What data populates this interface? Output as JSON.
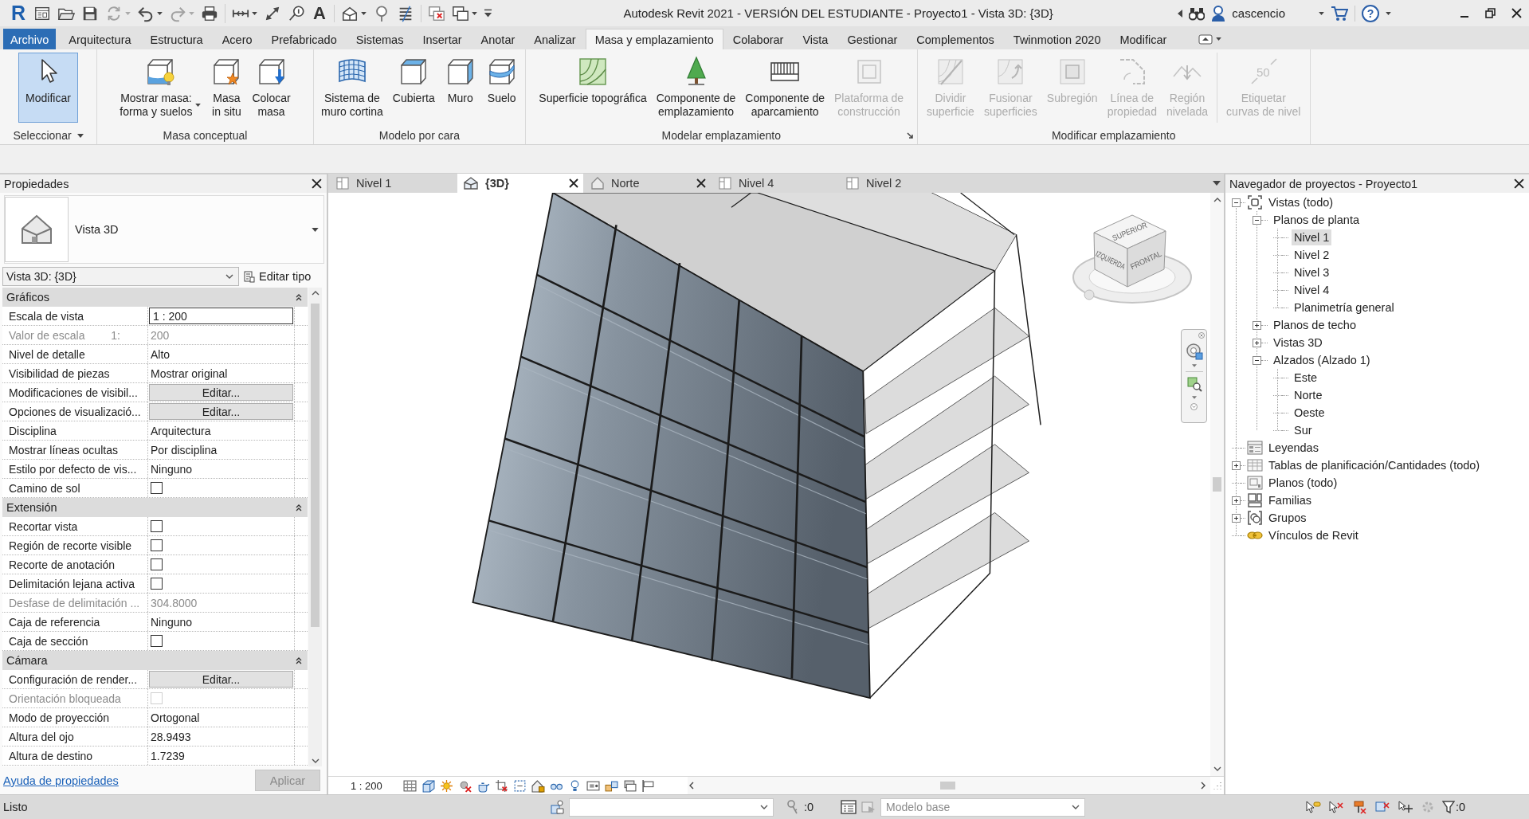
{
  "title_bar": {
    "quick_access": [
      {
        "items": [
          {
            "kind": "app",
            "glyph": "R",
            "disabled": false
          },
          {
            "kind": "home",
            "disabled": false
          },
          {
            "kind": "open",
            "disabled": false
          },
          {
            "kind": "save",
            "disabled": false
          },
          {
            "kind": "sync",
            "menu": true,
            "disabled": true
          },
          {
            "kind": "undo",
            "menu": true,
            "disabled": false
          },
          {
            "kind": "redo",
            "menu": true,
            "disabled": true
          },
          {
            "kind": "print",
            "disabled": false
          }
        ]
      },
      {
        "items": [
          {
            "kind": "measure",
            "menu": true,
            "disabled": false
          },
          {
            "kind": "dimension",
            "disabled": false
          },
          {
            "kind": "tag",
            "disabled": false
          },
          {
            "kind": "text",
            "glyph": "A",
            "disabled": false
          }
        ]
      },
      {
        "items": [
          {
            "kind": "view3d",
            "menu": true,
            "disabled": false
          },
          {
            "kind": "section",
            "disabled": false
          },
          {
            "kind": "thinlines",
            "disabled": false
          }
        ]
      },
      {
        "items": [
          {
            "kind": "closewindows",
            "disabled": false
          },
          {
            "kind": "switchwindows",
            "menu": true,
            "disabled": false
          },
          {
            "kind": "customize",
            "disabled": false
          }
        ]
      }
    ],
    "title": "Autodesk Revit 2021 - VERSIÓN DEL ESTUDIANTE - Proyecto1 - Vista 3D: {3D}",
    "user": "cascencio",
    "help_glyph": "?"
  },
  "ribbon": {
    "tabs": [
      {
        "label": "Archivo",
        "kind": "file",
        "selected": false
      },
      {
        "label": "Arquitectura",
        "kind": "tab",
        "selected": false
      },
      {
        "label": "Estructura",
        "kind": "tab",
        "selected": false
      },
      {
        "label": "Acero",
        "kind": "tab",
        "selected": false
      },
      {
        "label": "Prefabricado",
        "kind": "tab",
        "selected": false
      },
      {
        "label": "Sistemas",
        "kind": "tab",
        "selected": false
      },
      {
        "label": "Insertar",
        "kind": "tab",
        "selected": false
      },
      {
        "label": "Anotar",
        "kind": "tab",
        "selected": false
      },
      {
        "label": "Analizar",
        "kind": "tab",
        "selected": false
      },
      {
        "label": "Masa y emplazamiento",
        "kind": "tab",
        "selected": true
      },
      {
        "label": "Colaborar",
        "kind": "tab",
        "selected": false
      },
      {
        "label": "Vista",
        "kind": "tab",
        "selected": false
      },
      {
        "label": "Gestionar",
        "kind": "tab",
        "selected": false
      },
      {
        "label": "Complementos",
        "kind": "tab",
        "selected": false
      },
      {
        "label": "Twinmotion 2020",
        "kind": "tab",
        "selected": false
      },
      {
        "label": "Modificar",
        "kind": "tab",
        "selected": false
      }
    ],
    "panels": [
      {
        "title": "Seleccionar",
        "menu": true,
        "groups": [
          {
            "buttons": [
              {
                "kind": "select",
                "label": "Modificar",
                "active": true,
                "disabled": false
              }
            ]
          }
        ]
      },
      {
        "title": "Masa conceptual",
        "groups": [
          {
            "buttons": [
              {
                "kind": "showmass",
                "label": "Mostrar masa:\nforma y suelos",
                "active": false,
                "disabled": false,
                "menu": true
              },
              {
                "kind": "inplace",
                "label": "Masa\nin situ",
                "active": false,
                "disabled": false
              },
              {
                "kind": "placemass",
                "label": "Colocar\nmasa",
                "active": false,
                "disabled": false
              }
            ]
          }
        ]
      },
      {
        "title": "Modelo por cara",
        "groups": [
          {
            "buttons": [
              {
                "kind": "curtain",
                "label": "Sistema de\nmuro cortina",
                "active": false,
                "disabled": false
              },
              {
                "kind": "roof",
                "label": "Cubierta",
                "active": false,
                "disabled": false
              },
              {
                "kind": "wall",
                "label": "Muro",
                "active": false,
                "disabled": false
              },
              {
                "kind": "floor",
                "label": "Suelo",
                "active": false,
                "disabled": false
              }
            ]
          }
        ]
      },
      {
        "title": "Modelar emplazamiento",
        "launcher": true,
        "groups": [
          {
            "buttons": [
              {
                "kind": "topo",
                "label": "Superficie topográfica",
                "active": false,
                "disabled": false
              },
              {
                "kind": "sitecomp",
                "label": "Componente de\nemplazamiento",
                "active": false,
                "disabled": false
              },
              {
                "kind": "parking",
                "label": "Componente de\naparcamiento",
                "active": false,
                "disabled": false
              },
              {
                "kind": "pad",
                "label": "Plataforma de\nconstrucción",
                "active": false,
                "disabled": true
              }
            ]
          }
        ]
      },
      {
        "title": "Modificar emplazamiento",
        "groups": [
          {
            "buttons": [
              {
                "kind": "split",
                "label": "Dividir\nsuperficie",
                "active": false,
                "disabled": true
              },
              {
                "kind": "merge",
                "label": "Fusionar\nsuperficies",
                "active": false,
                "disabled": true
              },
              {
                "kind": "subregion",
                "label": "Subregión",
                "active": false,
                "disabled": true
              },
              {
                "kind": "propline",
                "label": "Línea de\npropiedad",
                "active": false,
                "disabled": true
              },
              {
                "kind": "graded",
                "label": "Región\nnivelada",
                "active": false,
                "disabled": true
              }
            ]
          },
          {
            "buttons": [
              {
                "kind": "contours",
                "label": "Etiquetar\ncurvas de nivel",
                "icon_text": "50",
                "active": false,
                "disabled": true
              }
            ]
          }
        ]
      }
    ]
  },
  "properties": {
    "title": "Propiedades",
    "type_name": "Vista 3D",
    "instance": "Vista 3D: {3D}",
    "edit_type": "Editar tipo",
    "sections": [
      {
        "title": "Gráficos",
        "expanded": true,
        "rows": [
          {
            "label": "Escala de vista",
            "kind": "input",
            "value": "1 : 200",
            "disabled": false
          },
          {
            "label": "Valor de escala",
            "unit": "1:",
            "kind": "text",
            "value": "200",
            "disabled": true
          },
          {
            "label": "Nivel de detalle",
            "kind": "text",
            "value": "Alto",
            "disabled": false
          },
          {
            "label": "Visibilidad de piezas",
            "kind": "text",
            "value": "Mostrar original",
            "disabled": false
          },
          {
            "label": "Modificaciones de visibil...",
            "kind": "button",
            "value": "Editar...",
            "disabled": false
          },
          {
            "label": "Opciones de visualizació...",
            "kind": "button",
            "value": "Editar...",
            "disabled": false
          },
          {
            "label": "Disciplina",
            "kind": "text",
            "value": "Arquitectura",
            "disabled": false
          },
          {
            "label": "Mostrar líneas ocultas",
            "kind": "text",
            "value": "Por disciplina",
            "disabled": false
          },
          {
            "label": "Estilo por defecto de vis...",
            "kind": "text",
            "value": "Ninguno",
            "disabled": false
          },
          {
            "label": "Camino de sol",
            "kind": "checkbox",
            "checked": false,
            "disabled": false
          }
        ]
      },
      {
        "title": "Extensión",
        "expanded": true,
        "rows": [
          {
            "label": "Recortar vista",
            "kind": "checkbox",
            "checked": false,
            "disabled": false
          },
          {
            "label": "Región de recorte visible",
            "kind": "checkbox",
            "checked": false,
            "disabled": false
          },
          {
            "label": "Recorte de anotación",
            "kind": "checkbox",
            "checked": false,
            "disabled": false
          },
          {
            "label": "Delimitación lejana activa",
            "kind": "checkbox",
            "checked": false,
            "disabled": false
          },
          {
            "label": "Desfase de delimitación ...",
            "kind": "text",
            "value": "304.8000",
            "disabled": true
          },
          {
            "label": "Caja de referencia",
            "kind": "text",
            "value": "Ninguno",
            "disabled": false
          },
          {
            "label": "Caja de sección",
            "kind": "checkbox",
            "checked": false,
            "disabled": false
          }
        ]
      },
      {
        "title": "Cámara",
        "expanded": true,
        "rows": [
          {
            "label": "Configuración de render...",
            "kind": "button",
            "value": "Editar...",
            "disabled": false
          },
          {
            "label": "Orientación bloqueada",
            "kind": "checkbox",
            "checked": false,
            "disabled": true
          },
          {
            "label": "Modo de proyección",
            "kind": "text",
            "value": "Ortogonal",
            "disabled": false
          },
          {
            "label": "Altura del ojo",
            "kind": "text",
            "value": "28.9493",
            "disabled": false
          },
          {
            "label": "Altura de destino",
            "kind": "text",
            "value": "1.7239",
            "disabled": false
          }
        ]
      }
    ],
    "help_link": "Ayuda de propiedades",
    "apply": {
      "label": "Aplicar",
      "disabled": true
    }
  },
  "view": {
    "tabs": [
      {
        "label": "Nivel 1",
        "kind": "plan",
        "selected": false
      },
      {
        "label": "{3D}",
        "kind": "model",
        "selected": true,
        "closable": true
      },
      {
        "label": "Norte",
        "kind": "elevation",
        "selected": false,
        "closable": true
      },
      {
        "label": "Nivel 4",
        "kind": "plan",
        "selected": false
      },
      {
        "label": "Nivel 2",
        "kind": "plan",
        "selected": false
      }
    ],
    "view_cube": {
      "top": "SUPERIOR",
      "left": "IZQUIERDA",
      "right": "FRONTAL"
    },
    "scale": "1 : 200"
  },
  "project_browser": {
    "title": "Navegador de proyectos - Proyecto1",
    "tree": [
      {
        "label": "Vistas (todo)",
        "kind": "views",
        "expanded": true,
        "selected": false,
        "children": [
          {
            "label": "Planos de planta",
            "expanded": true,
            "selected": false,
            "children": [
              {
                "label": "Nivel 1",
                "selected": true
              },
              {
                "label": "Nivel 2",
                "selected": false
              },
              {
                "label": "Nivel 3",
                "selected": false
              },
              {
                "label": "Nivel 4",
                "selected": false
              },
              {
                "label": "Planimetría general",
                "selected": false
              }
            ]
          },
          {
            "label": "Planos de techo",
            "expanded": false,
            "selected": false
          },
          {
            "label": "Vistas 3D",
            "expanded": false,
            "selected": false
          },
          {
            "label": "Alzados (Alzado 1)",
            "expanded": true,
            "selected": false,
            "children": [
              {
                "label": "Este",
                "selected": false
              },
              {
                "label": "Norte",
                "selected": false
              },
              {
                "label": "Oeste",
                "selected": false
              },
              {
                "label": "Sur",
                "selected": false
              }
            ]
          }
        ]
      },
      {
        "label": "Leyendas",
        "kind": "legends",
        "selected": false
      },
      {
        "label": "Tablas de planificación/Cantidades (todo)",
        "kind": "schedules",
        "expanded": false,
        "selected": false
      },
      {
        "label": "Planos (todo)",
        "kind": "sheets",
        "selected": false
      },
      {
        "label": "Familias",
        "kind": "families",
        "expanded": false,
        "selected": false
      },
      {
        "label": "Grupos",
        "kind": "groups",
        "expanded": false,
        "selected": false
      },
      {
        "label": "Vínculos de Revit",
        "kind": "links",
        "selected": false
      }
    ]
  },
  "status_bar": {
    "message": "Listo",
    "editable_count": ":0",
    "design_option": {
      "value": "Modelo base",
      "disabled": true
    },
    "filter_count": ":0"
  }
}
